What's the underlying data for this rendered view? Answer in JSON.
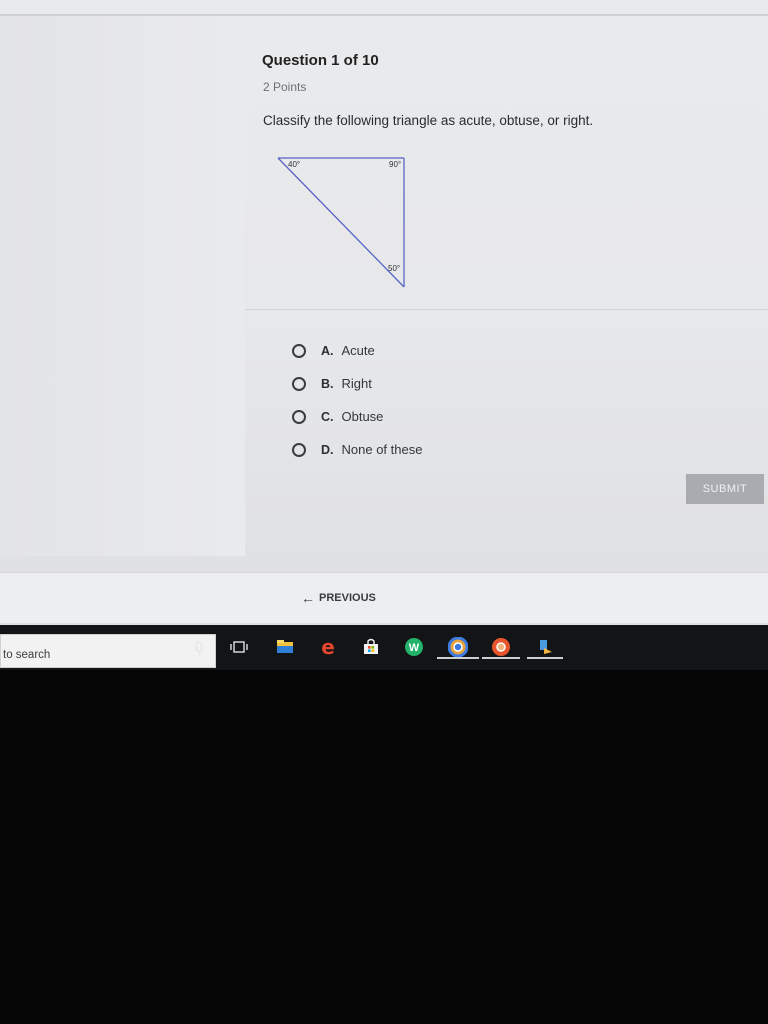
{
  "question": {
    "title": "Question 1 of 10",
    "points": "2 Points",
    "prompt": "Classify the following triangle as acute, obtuse, or right."
  },
  "triangle": {
    "angles": {
      "top_left": "40°",
      "top_right": "90°",
      "bottom": "50°"
    },
    "line_color": "#5a63c7"
  },
  "choices": [
    {
      "letter": "A.",
      "text": "Acute"
    },
    {
      "letter": "B.",
      "text": "Right"
    },
    {
      "letter": "C.",
      "text": "Obtuse"
    },
    {
      "letter": "D.",
      "text": "None of these"
    }
  ],
  "actions": {
    "submit_label": "SUBMIT",
    "previous_label": "PREVIOUS"
  },
  "taskbar": {
    "search_text": "to search",
    "icons": [
      "mic-icon",
      "task-view-icon",
      "file-explorer-icon",
      "edge-icon",
      "store-icon",
      "w-app-icon",
      "chrome-icon",
      "chrome-alt-icon",
      "app-icon"
    ]
  }
}
